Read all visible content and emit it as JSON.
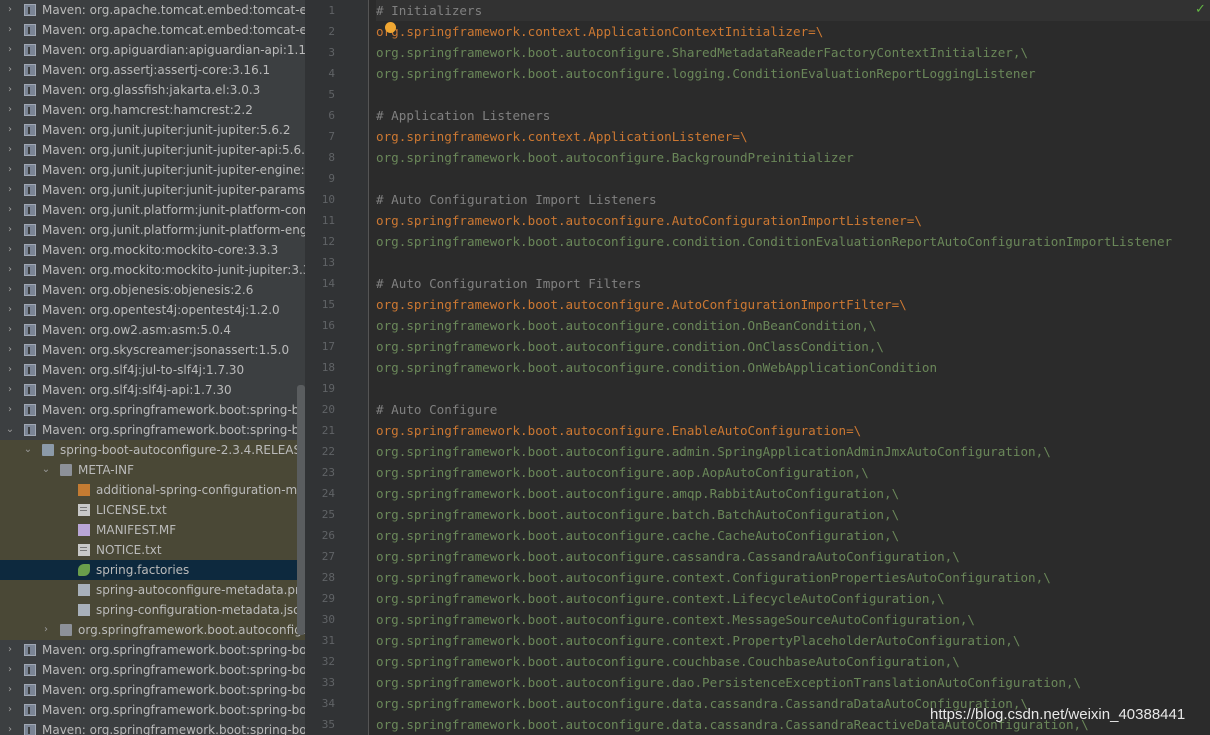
{
  "tree": {
    "rows": [
      {
        "label": "Maven: org.apache.tomcat.embed:tomcat-em",
        "icon": "library-icon",
        "depth": 0,
        "arrow": "collapsed"
      },
      {
        "label": "Maven: org.apache.tomcat.embed:tomcat-em",
        "icon": "library-icon",
        "depth": 0,
        "arrow": "collapsed"
      },
      {
        "label": "Maven: org.apiguardian:apiguardian-api:1.1.0",
        "icon": "library-icon",
        "depth": 0,
        "arrow": "collapsed"
      },
      {
        "label": "Maven: org.assertj:assertj-core:3.16.1",
        "icon": "library-icon",
        "depth": 0,
        "arrow": "collapsed"
      },
      {
        "label": "Maven: org.glassfish:jakarta.el:3.0.3",
        "icon": "library-icon",
        "depth": 0,
        "arrow": "collapsed"
      },
      {
        "label": "Maven: org.hamcrest:hamcrest:2.2",
        "icon": "library-icon",
        "depth": 0,
        "arrow": "collapsed"
      },
      {
        "label": "Maven: org.junit.jupiter:junit-jupiter:5.6.2",
        "icon": "library-icon",
        "depth": 0,
        "arrow": "collapsed"
      },
      {
        "label": "Maven: org.junit.jupiter:junit-jupiter-api:5.6.2",
        "icon": "library-icon",
        "depth": 0,
        "arrow": "collapsed"
      },
      {
        "label": "Maven: org.junit.jupiter:junit-jupiter-engine:5.6",
        "icon": "library-icon",
        "depth": 0,
        "arrow": "collapsed"
      },
      {
        "label": "Maven: org.junit.jupiter:junit-jupiter-params:5",
        "icon": "library-icon",
        "depth": 0,
        "arrow": "collapsed"
      },
      {
        "label": "Maven: org.junit.platform:junit-platform-comm",
        "icon": "library-icon",
        "depth": 0,
        "arrow": "collapsed"
      },
      {
        "label": "Maven: org.junit.platform:junit-platform-engir",
        "icon": "library-icon",
        "depth": 0,
        "arrow": "collapsed"
      },
      {
        "label": "Maven: org.mockito:mockito-core:3.3.3",
        "icon": "library-icon",
        "depth": 0,
        "arrow": "collapsed"
      },
      {
        "label": "Maven: org.mockito:mockito-junit-jupiter:3.3.3",
        "icon": "library-icon",
        "depth": 0,
        "arrow": "collapsed"
      },
      {
        "label": "Maven: org.objenesis:objenesis:2.6",
        "icon": "library-icon",
        "depth": 0,
        "arrow": "collapsed"
      },
      {
        "label": "Maven: org.opentest4j:opentest4j:1.2.0",
        "icon": "library-icon",
        "depth": 0,
        "arrow": "collapsed"
      },
      {
        "label": "Maven: org.ow2.asm:asm:5.0.4",
        "icon": "library-icon",
        "depth": 0,
        "arrow": "collapsed"
      },
      {
        "label": "Maven: org.skyscreamer:jsonassert:1.5.0",
        "icon": "library-icon",
        "depth": 0,
        "arrow": "collapsed"
      },
      {
        "label": "Maven: org.slf4j:jul-to-slf4j:1.7.30",
        "icon": "library-icon",
        "depth": 0,
        "arrow": "collapsed"
      },
      {
        "label": "Maven: org.slf4j:slf4j-api:1.7.30",
        "icon": "library-icon",
        "depth": 0,
        "arrow": "collapsed"
      },
      {
        "label": "Maven: org.springframework.boot:spring-bo",
        "icon": "library-icon",
        "depth": 0,
        "arrow": "collapsed"
      },
      {
        "label": "Maven: org.springframework.boot:spring-bo",
        "icon": "library-icon",
        "depth": 0,
        "arrow": "expanded"
      },
      {
        "label": "spring-boot-autoconfigure-2.3.4.RELEASE.",
        "icon": "jar-icon",
        "depth": 1,
        "arrow": "expanded",
        "tinted": true
      },
      {
        "label": "META-INF",
        "icon": "folder-icon",
        "depth": 2,
        "arrow": "expanded",
        "tinted": true
      },
      {
        "label": "additional-spring-configuration-met",
        "icon": "config-file-icon",
        "depth": 3,
        "arrow": "none",
        "tinted": true
      },
      {
        "label": "LICENSE.txt",
        "icon": "text-file-icon",
        "depth": 3,
        "arrow": "none",
        "tinted": true
      },
      {
        "label": "MANIFEST.MF",
        "icon": "manifest-file-icon",
        "depth": 3,
        "arrow": "none",
        "tinted": true
      },
      {
        "label": "NOTICE.txt",
        "icon": "text-file-icon",
        "depth": 3,
        "arrow": "none",
        "tinted": true
      },
      {
        "label": "spring.factories",
        "icon": "spring-factories-icon",
        "depth": 3,
        "arrow": "none",
        "selected": true
      },
      {
        "label": "spring-autoconfigure-metadata.prop",
        "icon": "properties-file-icon",
        "depth": 3,
        "arrow": "none",
        "tinted": true
      },
      {
        "label": "spring-configuration-metadata.json",
        "icon": "json-file-icon",
        "depth": 3,
        "arrow": "none",
        "tinted": true
      },
      {
        "label": "org.springframework.boot.autoconfigu",
        "icon": "package-icon",
        "depth": 2,
        "arrow": "collapsed",
        "tinted": true
      },
      {
        "label": "Maven: org.springframework.boot:spring-bo",
        "icon": "library-icon",
        "depth": 0,
        "arrow": "collapsed"
      },
      {
        "label": "Maven: org.springframework.boot:spring-bo",
        "icon": "library-icon",
        "depth": 0,
        "arrow": "collapsed"
      },
      {
        "label": "Maven: org.springframework.boot:spring-bo",
        "icon": "library-icon",
        "depth": 0,
        "arrow": "collapsed"
      },
      {
        "label": "Maven: org.springframework.boot:spring-bo",
        "icon": "library-icon",
        "depth": 0,
        "arrow": "collapsed"
      },
      {
        "label": "Maven: org.springframework.boot:spring-bo",
        "icon": "library-icon",
        "depth": 0,
        "arrow": "collapsed"
      }
    ]
  },
  "editor": {
    "lines": [
      {
        "n": "1",
        "text": "# Initializers",
        "kind": "comment"
      },
      {
        "n": "2",
        "text": "org.springframework.context.ApplicationContextInitializer=\\",
        "kind": "key"
      },
      {
        "n": "3",
        "text": "org.springframework.boot.autoconfigure.SharedMetadataReaderFactoryContextInitializer,\\",
        "kind": "value"
      },
      {
        "n": "4",
        "text": "org.springframework.boot.autoconfigure.logging.ConditionEvaluationReportLoggingListener",
        "kind": "value"
      },
      {
        "n": "5",
        "text": "",
        "kind": "value"
      },
      {
        "n": "6",
        "text": "# Application Listeners",
        "kind": "comment"
      },
      {
        "n": "7",
        "text": "org.springframework.context.ApplicationListener=\\",
        "kind": "key"
      },
      {
        "n": "8",
        "text": "org.springframework.boot.autoconfigure.BackgroundPreinitializer",
        "kind": "value"
      },
      {
        "n": "9",
        "text": "",
        "kind": "value"
      },
      {
        "n": "10",
        "text": "# Auto Configuration Import Listeners",
        "kind": "comment"
      },
      {
        "n": "11",
        "text": "org.springframework.boot.autoconfigure.AutoConfigurationImportListener=\\",
        "kind": "key"
      },
      {
        "n": "12",
        "text": "org.springframework.boot.autoconfigure.condition.ConditionEvaluationReportAutoConfigurationImportListener",
        "kind": "value"
      },
      {
        "n": "13",
        "text": "",
        "kind": "value"
      },
      {
        "n": "14",
        "text": "# Auto Configuration Import Filters",
        "kind": "comment"
      },
      {
        "n": "15",
        "text": "org.springframework.boot.autoconfigure.AutoConfigurationImportFilter=\\",
        "kind": "key"
      },
      {
        "n": "16",
        "text": "org.springframework.boot.autoconfigure.condition.OnBeanCondition,\\",
        "kind": "value"
      },
      {
        "n": "17",
        "text": "org.springframework.boot.autoconfigure.condition.OnClassCondition,\\",
        "kind": "value"
      },
      {
        "n": "18",
        "text": "org.springframework.boot.autoconfigure.condition.OnWebApplicationCondition",
        "kind": "value"
      },
      {
        "n": "19",
        "text": "",
        "kind": "value"
      },
      {
        "n": "20",
        "text": "# Auto Configure",
        "kind": "comment"
      },
      {
        "n": "21",
        "text": "org.springframework.boot.autoconfigure.EnableAutoConfiguration=\\",
        "kind": "key"
      },
      {
        "n": "22",
        "text": "org.springframework.boot.autoconfigure.admin.SpringApplicationAdminJmxAutoConfiguration,\\",
        "kind": "value"
      },
      {
        "n": "23",
        "text": "org.springframework.boot.autoconfigure.aop.AopAutoConfiguration,\\",
        "kind": "value"
      },
      {
        "n": "24",
        "text": "org.springframework.boot.autoconfigure.amqp.RabbitAutoConfiguration,\\",
        "kind": "value"
      },
      {
        "n": "25",
        "text": "org.springframework.boot.autoconfigure.batch.BatchAutoConfiguration,\\",
        "kind": "value"
      },
      {
        "n": "26",
        "text": "org.springframework.boot.autoconfigure.cache.CacheAutoConfiguration,\\",
        "kind": "value"
      },
      {
        "n": "27",
        "text": "org.springframework.boot.autoconfigure.cassandra.CassandraAutoConfiguration,\\",
        "kind": "value"
      },
      {
        "n": "28",
        "text": "org.springframework.boot.autoconfigure.context.ConfigurationPropertiesAutoConfiguration,\\",
        "kind": "value"
      },
      {
        "n": "29",
        "text": "org.springframework.boot.autoconfigure.context.LifecycleAutoConfiguration,\\",
        "kind": "value"
      },
      {
        "n": "30",
        "text": "org.springframework.boot.autoconfigure.context.MessageSourceAutoConfiguration,\\",
        "kind": "value"
      },
      {
        "n": "31",
        "text": "org.springframework.boot.autoconfigure.context.PropertyPlaceholderAutoConfiguration,\\",
        "kind": "value"
      },
      {
        "n": "32",
        "text": "org.springframework.boot.autoconfigure.couchbase.CouchbaseAutoConfiguration,\\",
        "kind": "value"
      },
      {
        "n": "33",
        "text": "org.springframework.boot.autoconfigure.dao.PersistenceExceptionTranslationAutoConfiguration,\\",
        "kind": "value"
      },
      {
        "n": "34",
        "text": "org.springframework.boot.autoconfigure.data.cassandra.CassandraDataAutoConfiguration,\\",
        "kind": "value"
      },
      {
        "n": "35",
        "text": "org.springframework.boot.autoconfigure.data.cassandra.CassandraReactiveDataAutoConfiguration,\\",
        "kind": "value"
      }
    ]
  },
  "status": {
    "check_glyph": "✓"
  },
  "watermark": {
    "text": "https://blog.csdn.net/weixin_40388441"
  }
}
